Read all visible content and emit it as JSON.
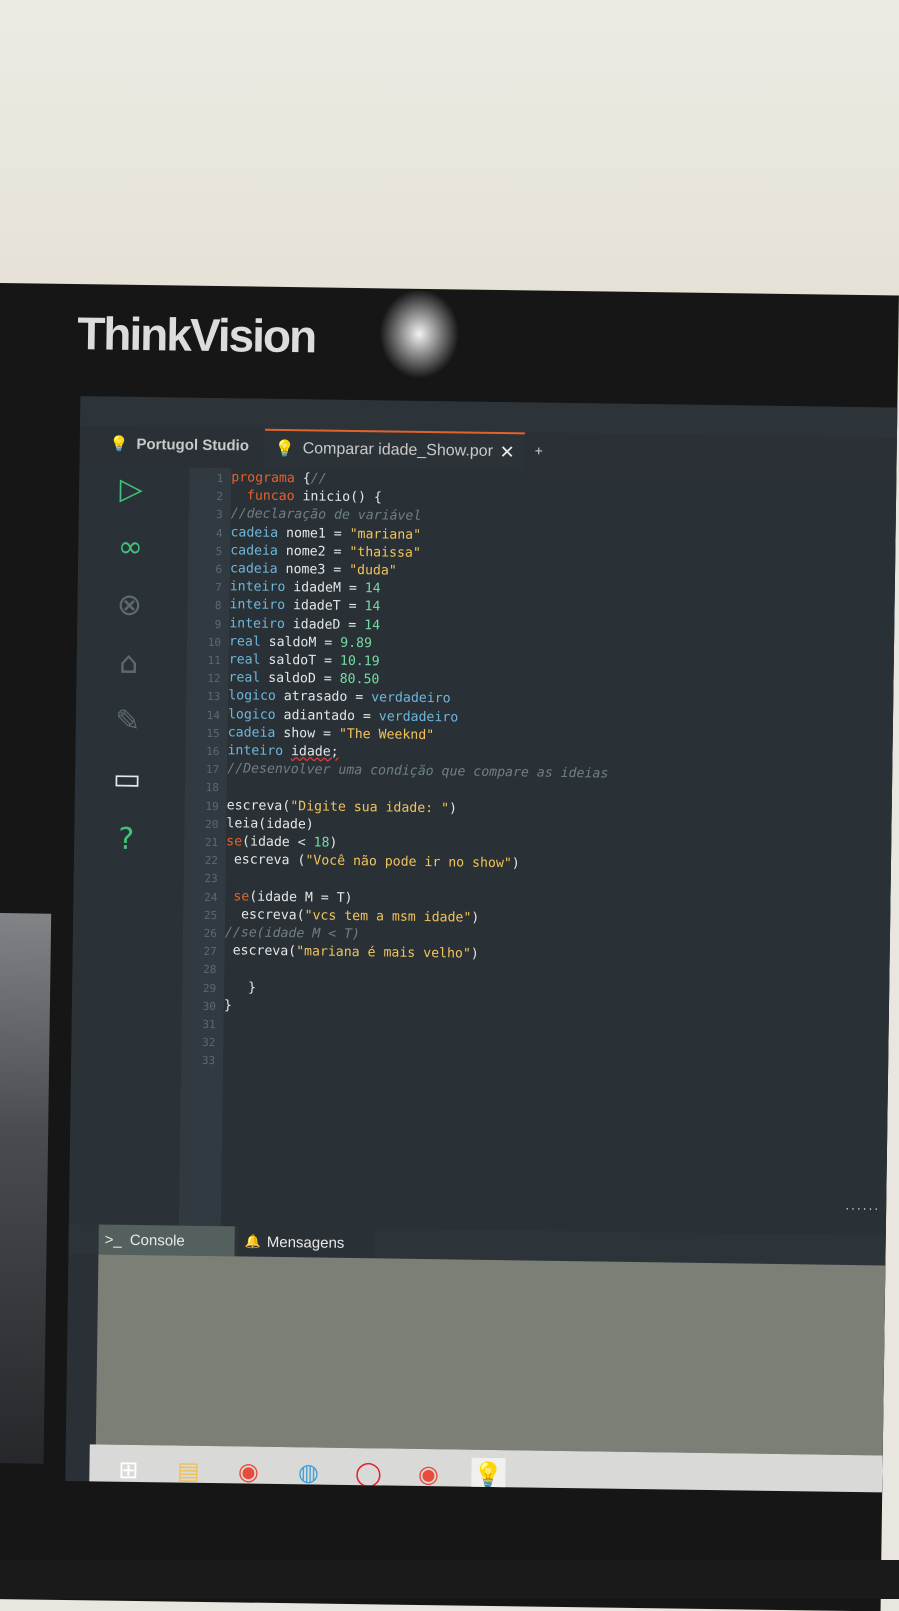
{
  "monitor": {
    "brand": "ThinkVision"
  },
  "app": {
    "title": "Portugol Studio"
  },
  "tab": {
    "label": "Comparar idade_Show.por",
    "close_glyph": "✕",
    "add_glyph": "+"
  },
  "tools": [
    {
      "name": "run-icon",
      "glyph": "▷",
      "color": "#3ec37a"
    },
    {
      "name": "debug-icon",
      "glyph": "∞",
      "color": "#3ec37a"
    },
    {
      "name": "stop-icon",
      "glyph": "⊗",
      "color": "#5b6a72"
    },
    {
      "name": "save-icon",
      "glyph": "⌂",
      "color": "#5b6a72"
    },
    {
      "name": "save-as-icon",
      "glyph": "✎",
      "color": "#5b6a72"
    },
    {
      "name": "folder-icon",
      "glyph": "▭",
      "color": "#e6e6e6"
    },
    {
      "name": "help-icon",
      "glyph": "?",
      "color": "#3ec37a"
    }
  ],
  "code": {
    "line_numbers": [
      "1",
      "2",
      "3",
      "4",
      "5",
      "6",
      "7",
      "8",
      "9",
      "10",
      "11",
      "12",
      "13",
      "14",
      "15",
      "16",
      "17",
      "18",
      "19",
      "20",
      "21",
      "22",
      "23",
      "24",
      "25",
      "26",
      "27",
      "28",
      "29",
      "30",
      "31",
      "32",
      "33"
    ],
    "lines": [
      [
        [
          "kw",
          "programa"
        ],
        [
          "pl",
          " {"
        ],
        [
          "co",
          "//"
        ]
      ],
      [
        [
          "pl",
          "  "
        ],
        [
          "kw",
          "funcao"
        ],
        [
          "pl",
          " inicio() {"
        ]
      ],
      [
        [
          "co",
          "//declaração de variável"
        ]
      ],
      [
        [
          "ty",
          "cadeia"
        ],
        [
          "pl",
          " nome1 = "
        ],
        [
          "st",
          "\"mariana\""
        ]
      ],
      [
        [
          "ty",
          "cadeia"
        ],
        [
          "pl",
          " nome2 = "
        ],
        [
          "st",
          "\"thaissa\""
        ]
      ],
      [
        [
          "ty",
          "cadeia"
        ],
        [
          "pl",
          " nome3 = "
        ],
        [
          "st",
          "\"duda\""
        ]
      ],
      [
        [
          "ty",
          "inteiro"
        ],
        [
          "pl",
          " idadeM = "
        ],
        [
          "nu",
          "14"
        ]
      ],
      [
        [
          "ty",
          "inteiro"
        ],
        [
          "pl",
          " idadeT = "
        ],
        [
          "nu",
          "14"
        ]
      ],
      [
        [
          "ty",
          "inteiro"
        ],
        [
          "pl",
          " idadeD = "
        ],
        [
          "nu",
          "14"
        ]
      ],
      [
        [
          "ty",
          "real"
        ],
        [
          "pl",
          " saldoM = "
        ],
        [
          "nu",
          "9.89"
        ]
      ],
      [
        [
          "ty",
          "real"
        ],
        [
          "pl",
          " saldoT = "
        ],
        [
          "nu",
          "10.19"
        ]
      ],
      [
        [
          "ty",
          "real"
        ],
        [
          "pl",
          " saldoD = "
        ],
        [
          "nu",
          "80.50"
        ]
      ],
      [
        [
          "ty",
          "logico"
        ],
        [
          "pl",
          " atrasado = "
        ],
        [
          "ty",
          "verdadeiro"
        ]
      ],
      [
        [
          "ty",
          "logico"
        ],
        [
          "pl",
          " adiantado = "
        ],
        [
          "ty",
          "verdadeiro"
        ]
      ],
      [
        [
          "ty",
          "cadeia"
        ],
        [
          "pl",
          " show = "
        ],
        [
          "st",
          "\"The Weeknd\""
        ]
      ],
      [
        [
          "ty",
          "inteiro"
        ],
        [
          "pl",
          " "
        ],
        [
          "sq",
          "idade;"
        ]
      ],
      [
        [
          "co",
          "//Desenvolver uma condição que compare as ideias"
        ]
      ],
      [],
      [
        [
          "pl",
          "escreva("
        ],
        [
          "st",
          "\"Digite sua idade: \""
        ],
        [
          "pl",
          ")"
        ]
      ],
      [
        [
          "pl",
          "leia(idade)"
        ]
      ],
      [
        [
          "kw",
          "se"
        ],
        [
          "pl",
          "(idade < "
        ],
        [
          "nu",
          "18"
        ],
        [
          "pl",
          ")"
        ]
      ],
      [
        [
          "pl",
          " escreva ("
        ],
        [
          "st",
          "\"Você não pode ir no show\""
        ],
        [
          "pl",
          ")"
        ]
      ],
      [],
      [
        [
          "pl",
          " "
        ],
        [
          "kw",
          "se"
        ],
        [
          "pl",
          "(idade M = T)"
        ]
      ],
      [
        [
          "pl",
          "  escreva("
        ],
        [
          "st",
          "\"vcs tem a msm idade\""
        ],
        [
          "pl",
          ")"
        ]
      ],
      [
        [
          "co",
          "//se(idade M < T)"
        ]
      ],
      [
        [
          "pl",
          " escreva("
        ],
        [
          "st",
          "\"mariana é mais velho\""
        ],
        [
          "pl",
          ")"
        ]
      ],
      [],
      [
        [
          "pl",
          "   }"
        ]
      ],
      [
        [
          "pl",
          "}"
        ]
      ],
      [],
      [],
      []
    ]
  },
  "bottom_tabs": {
    "console": "Console",
    "console_icon": ">_",
    "messages": "Mensagens",
    "messages_icon": "🔔"
  },
  "taskbar": [
    {
      "name": "windows-start-icon",
      "glyph": "⊞",
      "color": "#ffffff"
    },
    {
      "name": "file-explorer-icon",
      "glyph": "▤",
      "color": "#f2c14e"
    },
    {
      "name": "chrome-icon",
      "glyph": "◉",
      "color": "#e84c3d"
    },
    {
      "name": "browser-icon",
      "glyph": "◍",
      "color": "#3ea0d8"
    },
    {
      "name": "opera-icon",
      "glyph": "◯",
      "color": "#e5202e"
    },
    {
      "name": "chrome-profile-icon",
      "glyph": "◉",
      "color": "#e84c3d"
    },
    {
      "name": "portugol-studio-taskbar-icon",
      "glyph": "💡",
      "color": "#e6b63a"
    }
  ]
}
